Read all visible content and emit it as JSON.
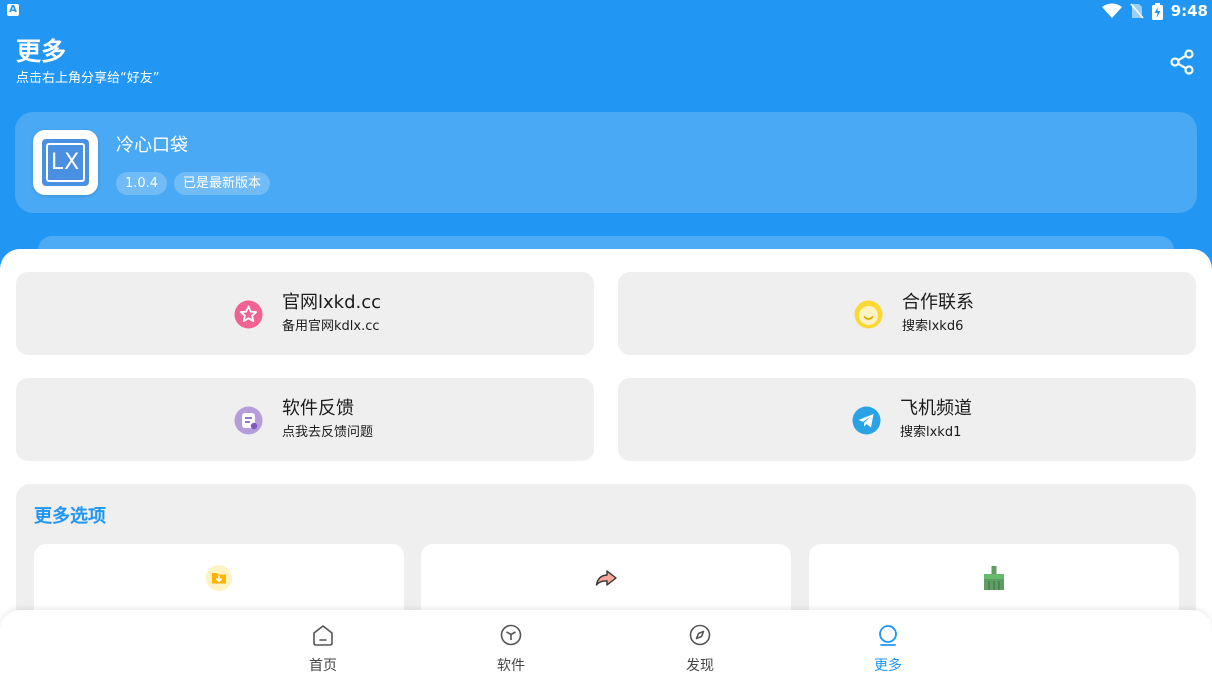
{
  "status_bar": {
    "time": "9:48",
    "app_badge": "A"
  },
  "header": {
    "title": "更多",
    "subtitle": "点击右上角分享给“好友”"
  },
  "app_card": {
    "logo_text": "LX",
    "name": "冷心口袋",
    "version": "1.0.4",
    "update_status": "已是最新版本"
  },
  "tiles": [
    {
      "title": "官网lxkd.cc",
      "subtitle": "备用官网kdlx.cc",
      "icon": "star-icon",
      "color": "#F06292"
    },
    {
      "title": "合作联系",
      "subtitle": "搜索lxkd6",
      "icon": "smile-icon",
      "color": "#FBC02D"
    },
    {
      "title": "软件反馈",
      "subtitle": "点我去反馈问题",
      "icon": "feedback-icon",
      "color": "#9575CD"
    },
    {
      "title": "飞机频道",
      "subtitle": "搜索lxkd1",
      "icon": "telegram-icon",
      "color": "#2AA3E6"
    }
  ],
  "more_options": {
    "title": "更多选项",
    "cards": [
      {
        "icon": "download-folder-icon",
        "color": "#FFB300"
      },
      {
        "icon": "share-arrow-icon",
        "color": "#F48C82"
      },
      {
        "icon": "broom-icon",
        "color": "#5E9E63"
      }
    ]
  },
  "bottom_nav": {
    "items": [
      {
        "label": "首页",
        "icon": "home-icon",
        "active": false
      },
      {
        "label": "软件",
        "icon": "box-icon",
        "active": false
      },
      {
        "label": "发现",
        "icon": "compass-icon",
        "active": false
      },
      {
        "label": "更多",
        "icon": "more-circle-icon",
        "active": true
      }
    ]
  },
  "colors": {
    "primary": "#2196F3",
    "tile_bg": "#efefef"
  }
}
